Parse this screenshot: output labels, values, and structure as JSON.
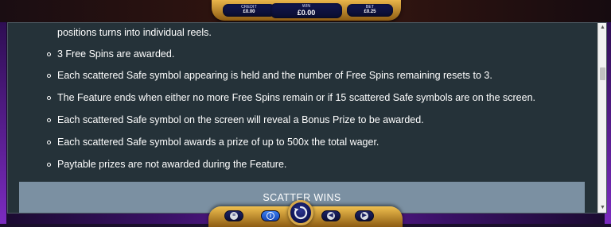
{
  "top_bar": {
    "credit": {
      "label": "CREDIT",
      "value": "£0.00"
    },
    "win": {
      "label": "WIN",
      "value": "£0.00"
    },
    "bet": {
      "label": "BET",
      "value": "£0.25"
    }
  },
  "paytable": {
    "continued_line": "positions turns into individual reels.",
    "items": [
      "3 Free Spins are awarded.",
      "Each scattered Safe symbol appearing is held and the number of Free Spins remaining resets to 3.",
      "The Feature ends when either no more Free Spins remain or if 15 scattered Safe symbols are on the screen.",
      "Each scattered Safe symbol on the screen will reveal a Bonus Prize to be awarded.",
      "Each scattered Safe symbol awards a prize of up to 500x the total wager.",
      "Paytable prizes are not awarded during the Feature."
    ],
    "section_header": "SCATTER WINS"
  },
  "controls": {
    "menu_icon": "menu-icon",
    "info_icon": "info-icon",
    "spin_icon": "spin-icon",
    "prev_icon": "previous-icon",
    "next_icon": "next-icon"
  },
  "colors": {
    "panel_bg": "#253239",
    "section_header_bg": "#7b90a2",
    "gold_frame": "#e9b54a",
    "meter_bg": "#11164f"
  }
}
